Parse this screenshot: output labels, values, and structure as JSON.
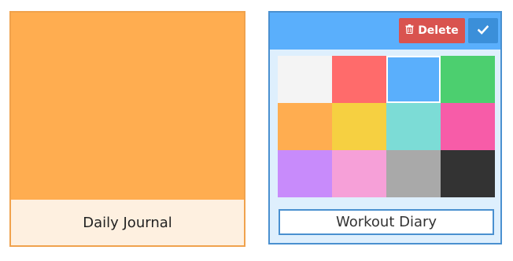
{
  "left_card": {
    "color": "#ffad50",
    "label_bg": "#fef0e0",
    "border_color": "#f0a24d",
    "title": "Daily Journal"
  },
  "right_card": {
    "header_color": "#5aaffc",
    "border_color": "#4a90d0",
    "delete_button": {
      "label": "Delete",
      "icon": "trash-icon",
      "color": "#d9534f"
    },
    "confirm_button": {
      "icon": "check-icon",
      "color": "#3b8fd9"
    },
    "palette": [
      {
        "name": "white",
        "hex": "#f4f4f4",
        "selected": false
      },
      {
        "name": "red",
        "hex": "#ff6b6b",
        "selected": false
      },
      {
        "name": "blue",
        "hex": "#5aaffc",
        "selected": true
      },
      {
        "name": "green",
        "hex": "#4ccf6f",
        "selected": false
      },
      {
        "name": "orange",
        "hex": "#ffad50",
        "selected": false
      },
      {
        "name": "yellow",
        "hex": "#f6d041",
        "selected": false
      },
      {
        "name": "teal",
        "hex": "#7cdcd6",
        "selected": false
      },
      {
        "name": "pink",
        "hex": "#f75ca8",
        "selected": false
      },
      {
        "name": "purple",
        "hex": "#c88bfb",
        "selected": false
      },
      {
        "name": "light-pink",
        "hex": "#f6a0d8",
        "selected": false
      },
      {
        "name": "gray",
        "hex": "#a9a9a9",
        "selected": false
      },
      {
        "name": "dark",
        "hex": "#333333",
        "selected": false
      }
    ],
    "title_input": {
      "value": "Workout Diary"
    }
  }
}
